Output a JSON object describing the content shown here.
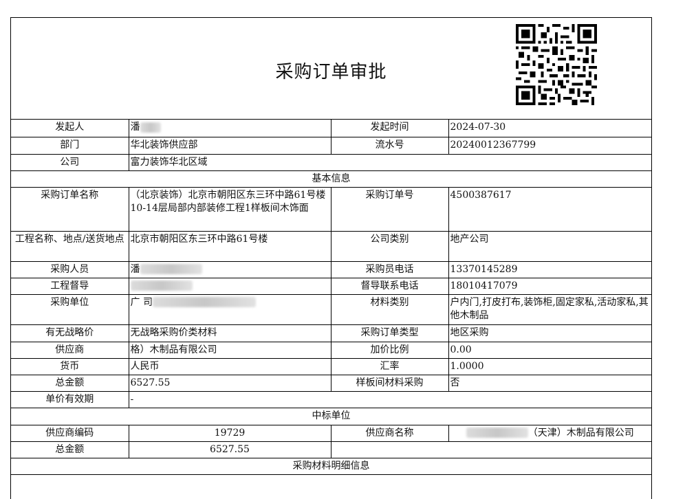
{
  "document": {
    "title": "采购订单审批"
  },
  "rows": {
    "initiator_label": "发起人",
    "initiator_value": "潘",
    "start_time_label": "发起时间",
    "start_time_value": "2024-07-30",
    "dept_label": "部门",
    "dept_value": "华北装饰供应部",
    "serial_label": "流水号",
    "serial_value": "20240012367799",
    "company_label": "公司",
    "company_value": "富力装饰华北区域"
  },
  "sections": {
    "basic_info": "基本信息",
    "winning_unit": "中标单位",
    "material_details": "采购材料明细信息"
  },
  "basic": {
    "order_name_label": "采购订单名称",
    "order_name_value": "（北京装饰）北京市朝阳区东三环中路61号楼10-14层局部内部装修工程1样板间木饰面",
    "order_no_label": "采购订单号",
    "order_no_value": "4500387617",
    "project_label": "工程名称、地点/送货地点",
    "project_value": "北京市朝阳区东三环中路61号楼",
    "company_type_label": "公司类别",
    "company_type_value": "地产公司",
    "buyer_label": "采购人员",
    "buyer_value": "潘",
    "buyer_phone_label": "采购员电话",
    "buyer_phone_value": "13370145289",
    "supervisor_label": "工程督导",
    "supervisor_value": "",
    "supervisor_phone_label": "督导联系电话",
    "supervisor_phone_value": "18010417079",
    "purchase_unit_label": "采购单位",
    "purchase_unit_value": "广 司",
    "material_type_label": "材料类别",
    "material_type_value": "户内门,打皮打布,装饰柜,固定家私,活动家私,其他木制品",
    "strategic_label": "有无战略价",
    "strategic_value": "无战略采购价类材料",
    "order_type_label": "采购订单类型",
    "order_type_value": "地区采购",
    "supplier_label": "供应商",
    "supplier_value": "格）木制品有限公司",
    "markup_label": "加价比例",
    "markup_value": "0.00",
    "currency_label": "货币",
    "currency_value": "人民币",
    "rate_label": "汇率",
    "rate_value": "1.0000",
    "total_label": "总金额",
    "total_value": "6527.55",
    "sample_label": "样板间材料采购",
    "sample_value": "否",
    "validity_label": "单价有效期",
    "validity_value": "-"
  },
  "winner": {
    "code_label": "供应商编码",
    "code_value": "19729",
    "name_label": "供应商名称",
    "name_value": "（天津）木制品有限公司",
    "total_label": "总金额",
    "total_value": "6527.55"
  }
}
